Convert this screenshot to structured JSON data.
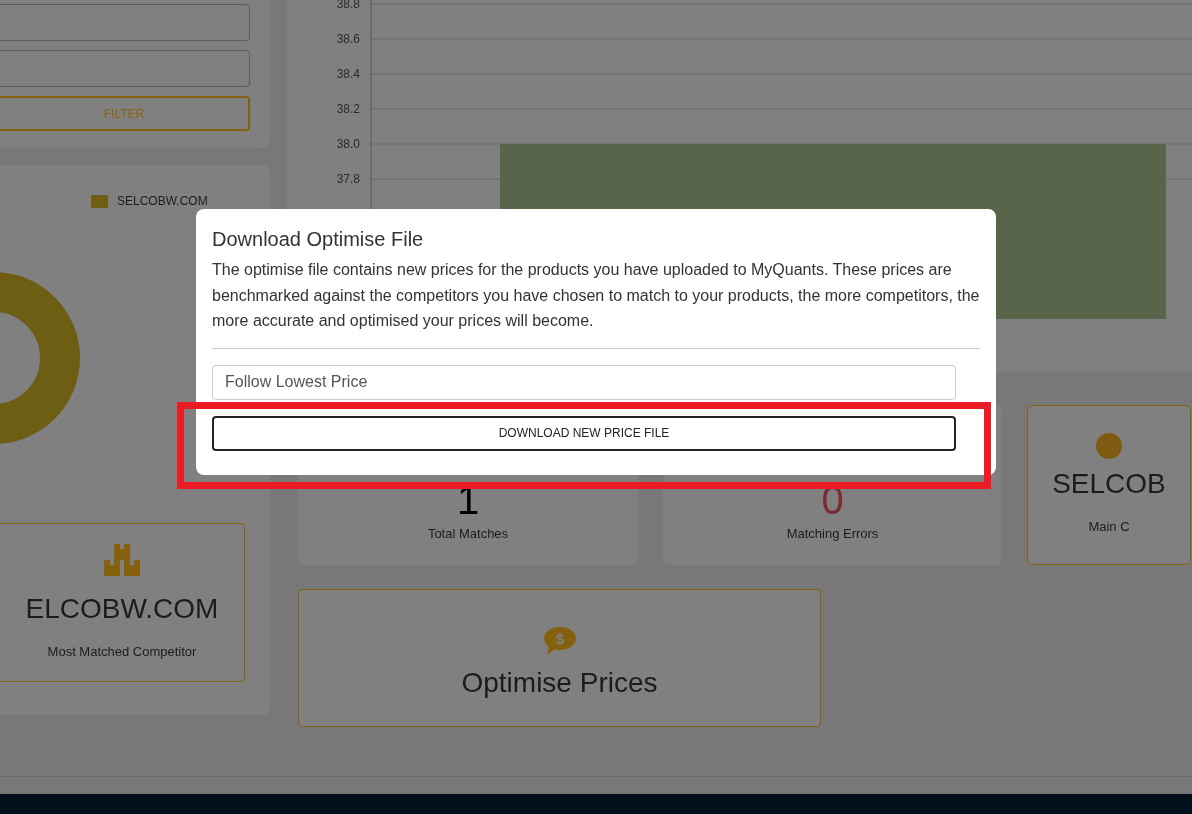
{
  "filter_panel": {
    "fields": [
      {
        "kind": "text"
      },
      {
        "kind": "text"
      }
    ],
    "button": "FILTER"
  },
  "competitor_panel": {
    "legend": [
      {
        "label": "SELCOBW.COM",
        "color": "#6e5e14"
      }
    ],
    "most_matched": {
      "value": "ELCOBW.COM",
      "label": "Most Matched Competitor"
    }
  },
  "price_chart": {
    "chart_data": {
      "type": "bar",
      "grid": true,
      "ylim": [
        37.0,
        38.8
      ],
      "yticks": [
        {
          "value": 37.8,
          "label": "37.8"
        },
        {
          "value": 38.0,
          "label": "38.0"
        },
        {
          "value": 38.2,
          "label": "38.2"
        },
        {
          "value": 38.4,
          "label": "38.4"
        },
        {
          "value": 38.6,
          "label": "38.6"
        },
        {
          "value": 38.8,
          "label": "38.8"
        }
      ],
      "values": [
        38.0
      ]
    }
  },
  "stats": [
    {
      "kind": "count",
      "value": "1",
      "label": "Total Matches"
    },
    {
      "kind": "error",
      "value": "0",
      "label": "Matching Errors"
    },
    {
      "kind": "highlight",
      "value": "SELCOB",
      "label": "Main C"
    }
  ],
  "optimise_card": {
    "icon_text": "$",
    "title": "Optimise Prices"
  },
  "modal": {
    "title": "Download Optimise File",
    "text": "The optimise file contains new prices for the products you have uploaded to MyQuants. These prices are benchmarked against the competitors you have chosen to match to your products, the more competitors, the more accurate and optimised your prices will become.",
    "select": {
      "value": "Follow Lowest Price"
    },
    "button": "DOWNLOAD NEW PRICE FILE"
  }
}
